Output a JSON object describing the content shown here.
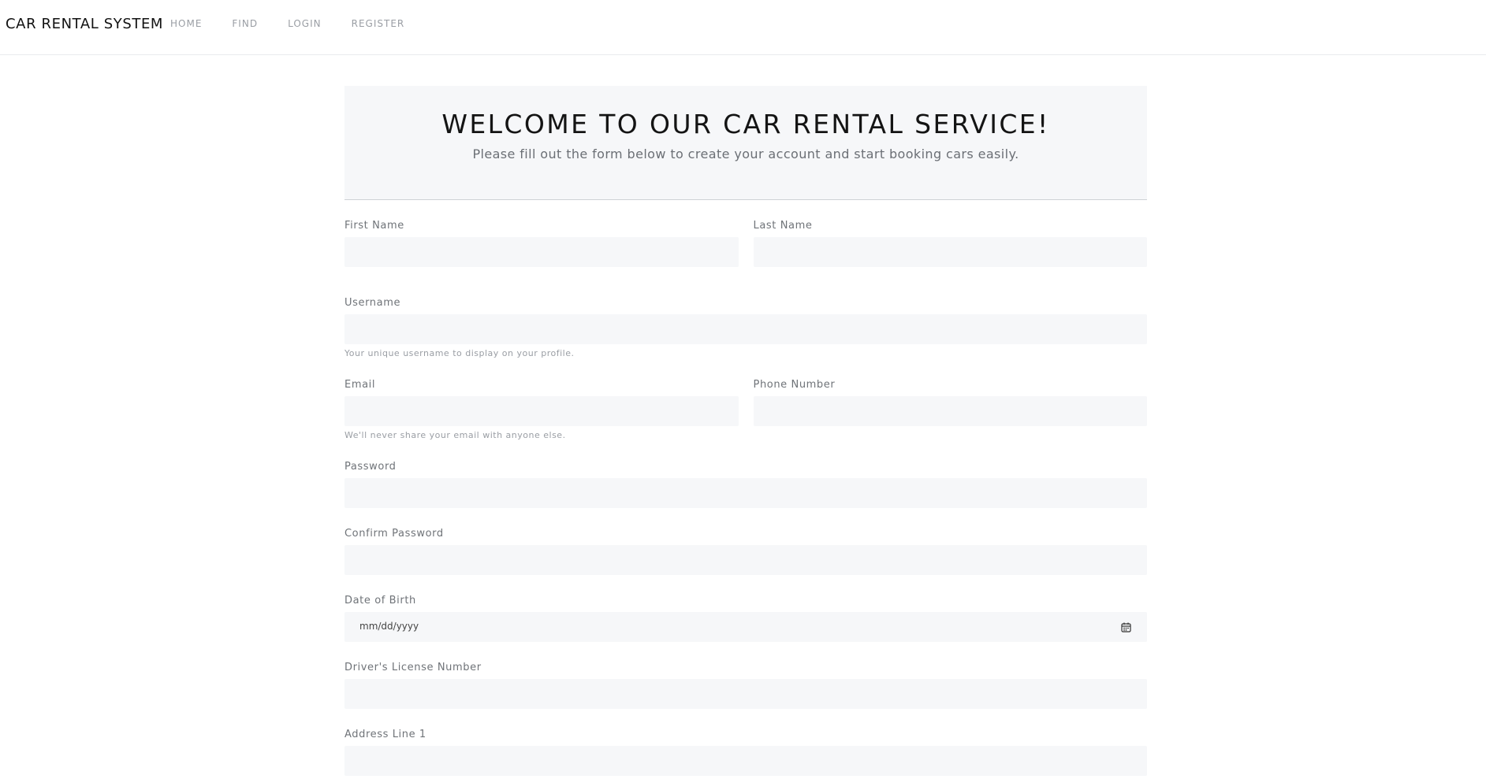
{
  "navbar": {
    "brand": "CAR RENTAL SYSTEM",
    "links": [
      "HOME",
      "FIND",
      "LOGIN",
      "REGISTER"
    ]
  },
  "hero": {
    "title": "WELCOME TO OUR CAR RENTAL SERVICE!",
    "subtitle": "Please fill out the form below to create your account and start booking cars easily."
  },
  "form": {
    "first_name_label": "First Name",
    "last_name_label": "Last Name",
    "username_label": "Username",
    "username_help": "Your unique username to display on your profile.",
    "email_label": "Email",
    "email_help": "We'll never share your email with anyone else.",
    "phone_label": "Phone Number",
    "password_label": "Password",
    "confirm_password_label": "Confirm Password",
    "dob_label": "Date of Birth",
    "dob_placeholder": "mm/dd/yyyy",
    "license_label": "Driver's License Number",
    "address1_label": "Address Line 1"
  },
  "icons": {
    "calendar": "calendar-icon"
  },
  "colors": {
    "input_bg": "#f6f7f9",
    "nav_link": "#9a9ea4",
    "hero_bg": "#f6f7f9"
  }
}
